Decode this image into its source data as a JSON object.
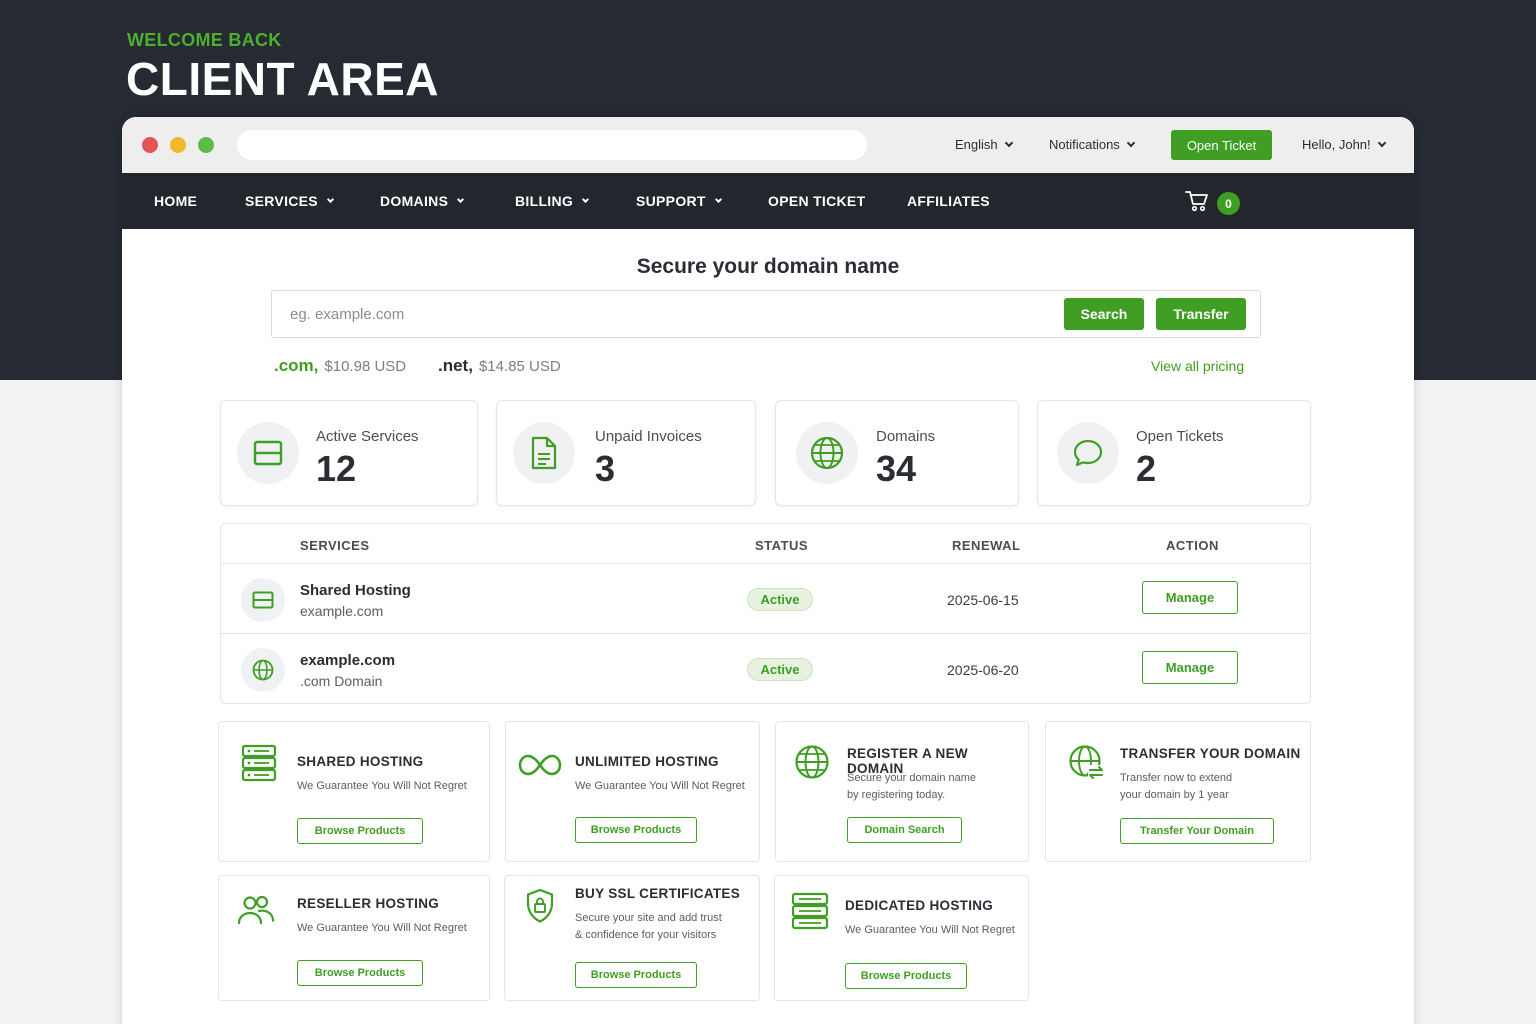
{
  "hero": {
    "eyebrow": "WELCOME BACK",
    "title": "CLIENT AREA"
  },
  "topbar": {
    "language": "English",
    "notifications": "Notifications",
    "open_ticket": "Open Ticket",
    "user_greeting": "Hello, John!"
  },
  "nav": {
    "items": [
      {
        "label": "HOME"
      },
      {
        "label": "SERVICES"
      },
      {
        "label": "DOMAINS"
      },
      {
        "label": "BILLING"
      },
      {
        "label": "SUPPORT"
      },
      {
        "label": "OPEN TICKET"
      },
      {
        "label": "AFFILIATES"
      }
    ],
    "cart_count": "0"
  },
  "domain_search": {
    "title": "Secure your domain name",
    "placeholder": "eg. example.com",
    "search_label": "Search",
    "transfer_label": "Transfer",
    "tlds": [
      {
        "ext": ".com,",
        "price": "$10.98 USD",
        "color": "#3f9e23"
      },
      {
        "ext": ".net,",
        "price": "$14.85 USD",
        "color": "#2a2d33"
      }
    ],
    "view_pricing": "View all pricing"
  },
  "stats": [
    {
      "label": "Active Services",
      "value": "12",
      "icon": "server-card-icon"
    },
    {
      "label": "Unpaid Invoices",
      "value": "3",
      "icon": "document-icon"
    },
    {
      "label": "Domains",
      "value": "34",
      "icon": "globe-icon"
    },
    {
      "label": "Open Tickets",
      "value": "2",
      "icon": "chat-bubble-icon"
    }
  ],
  "services_table": {
    "headers": {
      "services": "SERVICES",
      "status": "STATUS",
      "renewal": "RENEWAL",
      "action": "ACTION"
    },
    "rows": [
      {
        "name": "Shared Hosting",
        "sub": "example.com",
        "status": "Active",
        "renewal": "2025-06-15",
        "action": "Manage"
      },
      {
        "name": "example.com",
        "sub": ".com Domain",
        "status": "Active",
        "renewal": "2025-06-20",
        "action": "Manage"
      }
    ]
  },
  "products": [
    {
      "title": "SHARED HOSTING",
      "desc": "We Guarantee You Will Not Regret",
      "button": "Browse Products"
    },
    {
      "title": "UNLIMITED HOSTING",
      "desc": "We Guarantee You Will Not Regret",
      "button": "Browse Products"
    },
    {
      "title": "REGISTER A NEW DOMAIN",
      "desc1": "Secure your domain name",
      "desc2": "by registering today.",
      "button": "Domain Search"
    },
    {
      "title": "TRANSFER YOUR DOMAIN",
      "desc1": "Transfer now to extend",
      "desc2": "your domain by 1 year",
      "button": "Transfer Your Domain"
    },
    {
      "title": "RESELLER HOSTING",
      "desc": "We Guarantee You Will Not Regret",
      "button": "Browse Products"
    },
    {
      "title": "BUY SSL CERTIFICATES",
      "desc1": "Secure your site and add trust",
      "desc2": "& confidence for your visitors",
      "button": "Browse Products"
    },
    {
      "title": "DEDICATED HOSTING",
      "desc": "We Guarantee You Will Not Regret",
      "button": "Browse Products"
    }
  ],
  "colors": {
    "accent": "#3f9e23",
    "dark": "#252a33",
    "nav": "#22262d"
  }
}
